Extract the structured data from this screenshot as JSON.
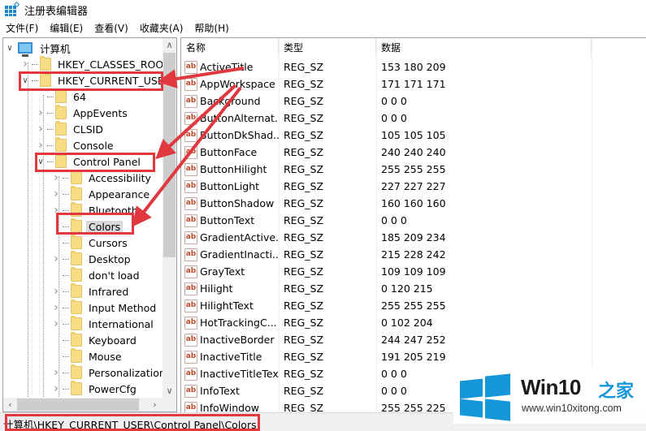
{
  "window": {
    "title": "注册表编辑器",
    "icon": "registry-editor-icon"
  },
  "menu": [
    {
      "label": "文件(F)"
    },
    {
      "label": "编辑(E)"
    },
    {
      "label": "查看(V)"
    },
    {
      "label": "收藏夹(A)"
    },
    {
      "label": "帮助(H)"
    }
  ],
  "tree": {
    "root": {
      "label": "计算机",
      "icon": "computer-icon",
      "expanded": true
    },
    "items": [
      {
        "label": "HKEY_CLASSES_ROOT",
        "level": 1,
        "expander": "collapsed"
      },
      {
        "label": "HKEY_CURRENT_USER",
        "level": 1,
        "expander": "expanded",
        "highlighted": true
      },
      {
        "label": "64",
        "level": 2,
        "expander": "none"
      },
      {
        "label": "AppEvents",
        "level": 2,
        "expander": "collapsed"
      },
      {
        "label": "CLSID",
        "level": 2,
        "expander": "collapsed"
      },
      {
        "label": "Console",
        "level": 2,
        "expander": "collapsed"
      },
      {
        "label": "Control Panel",
        "level": 2,
        "expander": "expanded",
        "highlighted": true
      },
      {
        "label": "Accessibility",
        "level": 3,
        "expander": "collapsed"
      },
      {
        "label": "Appearance",
        "level": 3,
        "expander": "collapsed"
      },
      {
        "label": "Bluetooth",
        "level": 3,
        "expander": "collapsed"
      },
      {
        "label": "Colors",
        "level": 3,
        "expander": "none",
        "selected": true,
        "highlighted": true
      },
      {
        "label": "Cursors",
        "level": 3,
        "expander": "none"
      },
      {
        "label": "Desktop",
        "level": 3,
        "expander": "collapsed"
      },
      {
        "label": "don't load",
        "level": 3,
        "expander": "none"
      },
      {
        "label": "Infrared",
        "level": 3,
        "expander": "collapsed"
      },
      {
        "label": "Input Method",
        "level": 3,
        "expander": "collapsed"
      },
      {
        "label": "International",
        "level": 3,
        "expander": "collapsed"
      },
      {
        "label": "Keyboard",
        "level": 3,
        "expander": "none"
      },
      {
        "label": "Mouse",
        "level": 3,
        "expander": "none"
      },
      {
        "label": "Personalization",
        "level": 3,
        "expander": "collapsed"
      },
      {
        "label": "PowerCfg",
        "level": 3,
        "expander": "collapsed"
      }
    ]
  },
  "list": {
    "columns": {
      "name": "名称",
      "type": "类型",
      "data": "数据"
    },
    "rows": [
      {
        "name": "ActiveTitle",
        "type": "REG_SZ",
        "data": "153 180 209"
      },
      {
        "name": "AppWorkspace",
        "type": "REG_SZ",
        "data": "171 171 171"
      },
      {
        "name": "Background",
        "type": "REG_SZ",
        "data": "0 0 0"
      },
      {
        "name": "ButtonAlternat...",
        "type": "REG_SZ",
        "data": "0 0 0"
      },
      {
        "name": "ButtonDkShad...",
        "type": "REG_SZ",
        "data": "105 105 105"
      },
      {
        "name": "ButtonFace",
        "type": "REG_SZ",
        "data": "240 240 240"
      },
      {
        "name": "ButtonHilight",
        "type": "REG_SZ",
        "data": "255 255 255"
      },
      {
        "name": "ButtonLight",
        "type": "REG_SZ",
        "data": "227 227 227"
      },
      {
        "name": "ButtonShadow",
        "type": "REG_SZ",
        "data": "160 160 160"
      },
      {
        "name": "ButtonText",
        "type": "REG_SZ",
        "data": "0 0 0"
      },
      {
        "name": "GradientActive...",
        "type": "REG_SZ",
        "data": "185 209 234"
      },
      {
        "name": "GradientInacti...",
        "type": "REG_SZ",
        "data": "215 228 242"
      },
      {
        "name": "GrayText",
        "type": "REG_SZ",
        "data": "109 109 109"
      },
      {
        "name": "Hilight",
        "type": "REG_SZ",
        "data": "0 120 215"
      },
      {
        "name": "HilightText",
        "type": "REG_SZ",
        "data": "255 255 255"
      },
      {
        "name": "HotTrackingC...",
        "type": "REG_SZ",
        "data": "0 102 204"
      },
      {
        "name": "InactiveBorder",
        "type": "REG_SZ",
        "data": "244 247 252"
      },
      {
        "name": "InactiveTitle",
        "type": "REG_SZ",
        "data": "191 205 219"
      },
      {
        "name": "InactiveTitleText",
        "type": "REG_SZ",
        "data": "0 0 0"
      },
      {
        "name": "InfoText",
        "type": "REG_SZ",
        "data": "0 0 0"
      },
      {
        "name": "InfoWindow",
        "type": "REG_SZ",
        "data": "255 255 225"
      }
    ]
  },
  "statusbar": {
    "path": "计算机\\HKEY_CURRENT_USER\\Control Panel\\Colors"
  },
  "watermark": {
    "brand": "Win10",
    "brand_cn": "之家",
    "url": "www.win10xitong.com"
  },
  "colors": {
    "annotation_red": "#e0383e",
    "accent_blue": "#1596d9",
    "selection_gray": "#d9d9d9"
  }
}
